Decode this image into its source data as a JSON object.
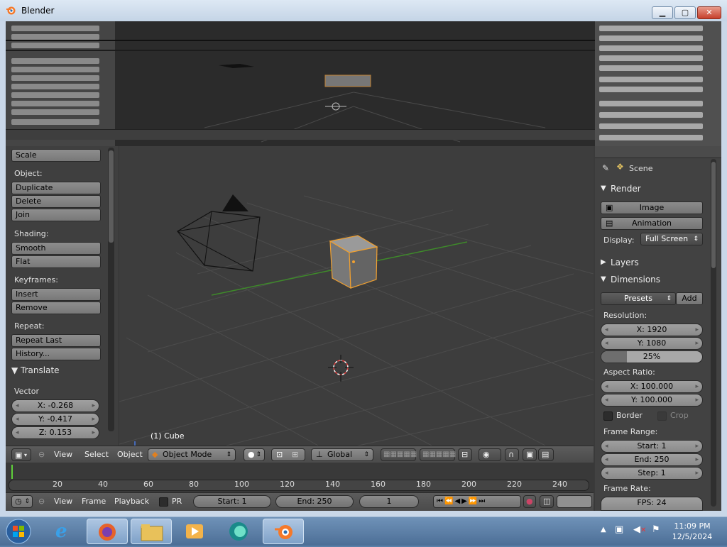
{
  "window": {
    "title": "Blender"
  },
  "toolshelf": {
    "scale": "Scale",
    "object_heading": "Object:",
    "duplicate": "Duplicate",
    "delete": "Delete",
    "join": "Join",
    "shading_heading": "Shading:",
    "smooth": "Smooth",
    "flat": "Flat",
    "keyframes_heading": "Keyframes:",
    "insert": "Insert",
    "remove": "Remove",
    "repeat_heading": "Repeat:",
    "repeat_last": "Repeat Last",
    "history": "History...",
    "translate_panel": "Translate",
    "vector_label": "Vector",
    "vector_x": "X: -0.268",
    "vector_y": "Y: -0.417",
    "vector_z": "Z: 0.153"
  },
  "viewport": {
    "object_label": "(1) Cube"
  },
  "view3d_header": {
    "view": "View",
    "select": "Select",
    "object": "Object",
    "mode": "Object Mode",
    "orientation": "Global"
  },
  "timeline": {
    "ticks": [
      "20",
      "40",
      "60",
      "80",
      "100",
      "120",
      "140",
      "160",
      "180",
      "200",
      "220",
      "240"
    ],
    "current_frame": 1
  },
  "timeline_header": {
    "view": "View",
    "frame": "Frame",
    "playback": "Playback",
    "pr": "PR",
    "start": "Start: 1",
    "end": "End: 250",
    "current": "1"
  },
  "properties": {
    "scene": "Scene",
    "render_panel": "Render",
    "image_button": "Image",
    "animation_button": "Animation",
    "display_label": "Display:",
    "display_value": "Full Screen",
    "layers_panel": "Layers",
    "dimensions_panel": "Dimensions",
    "presets": "Presets",
    "add": "Add",
    "resolution_label": "Resolution:",
    "res_x": "X: 1920",
    "res_y": "Y: 1080",
    "res_pct": "25%",
    "res_pct_value": 25,
    "aspect_label": "Aspect Ratio:",
    "aspect_x": "X: 100.000",
    "aspect_y": "Y: 100.000",
    "border": "Border",
    "crop": "Crop",
    "frame_range_label": "Frame Range:",
    "fr_start": "Start: 1",
    "fr_end": "End: 250",
    "fr_step": "Step: 1",
    "frame_rate_label": "Frame Rate:",
    "fps": "FPS: 24"
  },
  "taskbar": {
    "time": "11:09 PM",
    "date": "12/5/2024"
  },
  "colors": {
    "selection_outline": "#f0a030",
    "x_axis": "#4da62d",
    "timeline_cursor": "#5fcf3b"
  }
}
